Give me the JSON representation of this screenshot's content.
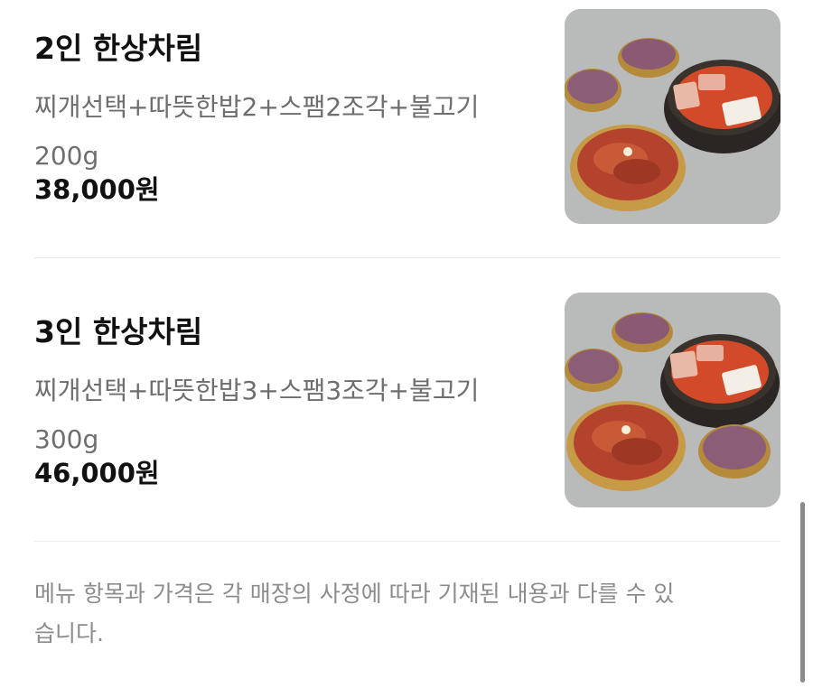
{
  "menu_items": [
    {
      "title": "2인 한상차림",
      "description_line1": "찌개선택+따뜻한밥2+스팸2조각+불고기",
      "description_line2": "200g",
      "price": "38,000원",
      "image_icon": "food-photo-icon"
    },
    {
      "title": "3인 한상차림",
      "description_line1": "찌개선택+따뜻한밥3+스팸3조각+불고기",
      "description_line2": "300g",
      "price": "46,000원",
      "image_icon": "food-photo-icon"
    }
  ],
  "notice": {
    "line1": "메뉴 항목과 가격은 각 매장의 사정에 따라 기재된 내용과 다를 수 있",
    "line2": "습니다."
  },
  "colors": {
    "title": "#111111",
    "description": "#6e6e6e",
    "notice": "#8c8c8c",
    "divider": "#ececec",
    "photo_background": "#b7b8b8"
  }
}
